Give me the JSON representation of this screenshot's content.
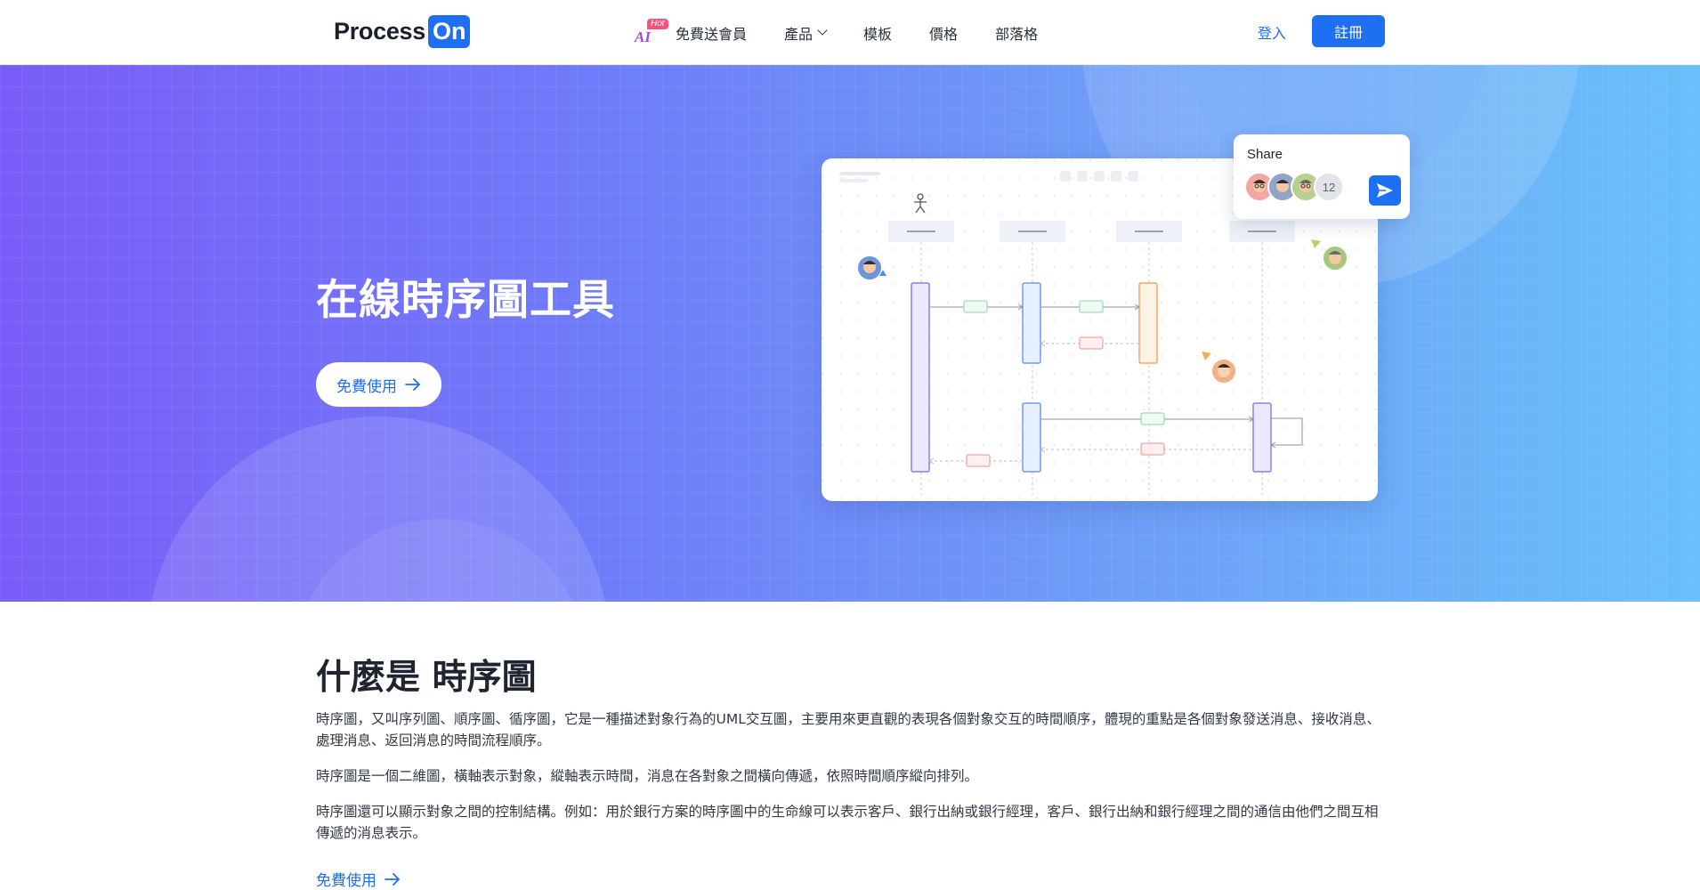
{
  "header": {
    "logo_process": "Process",
    "logo_on": "On",
    "ai_label": "AI",
    "ai_badge": "Hot",
    "nav": [
      {
        "label": "免費送會員"
      },
      {
        "label": "產品"
      },
      {
        "label": "模板"
      },
      {
        "label": "價格"
      },
      {
        "label": "部落格"
      }
    ],
    "login_label": "登入",
    "register_label": "註冊"
  },
  "hero": {
    "title": "在線時序圖工具",
    "cta_label": "免費使用",
    "share": {
      "title": "Share",
      "count": "12"
    }
  },
  "content": {
    "title": "什麼是 時序圖",
    "paragraphs": [
      "時序圖，又叫序列圖、順序圖、循序圖，它是一種描述對象行為的UML交互圖，主要用來更直觀的表現各個對象交互的時間順序，體現的重點是各個對象發送消息、接收消息、處理消息、返回消息的時間流程順序。",
      "時序圖是一個二維圖，橫軸表示對象，縱軸表示時間，消息在各對象之間橫向傳遞，依照時間順序縱向排列。",
      "時序圖還可以顯示對象之間的控制結構。例如：用於銀行方案的時序圖中的生命線可以表示客戶、銀行出納或銀行經理，客戶、銀行出納和銀行經理之間的通信由他們之間互相傳遞的消息表示。"
    ],
    "cta_label": "免費使用"
  },
  "colors": {
    "brand": "#1f6ff2",
    "hero_start": "#7a5cf8",
    "hero_end": "#69c0fa"
  }
}
